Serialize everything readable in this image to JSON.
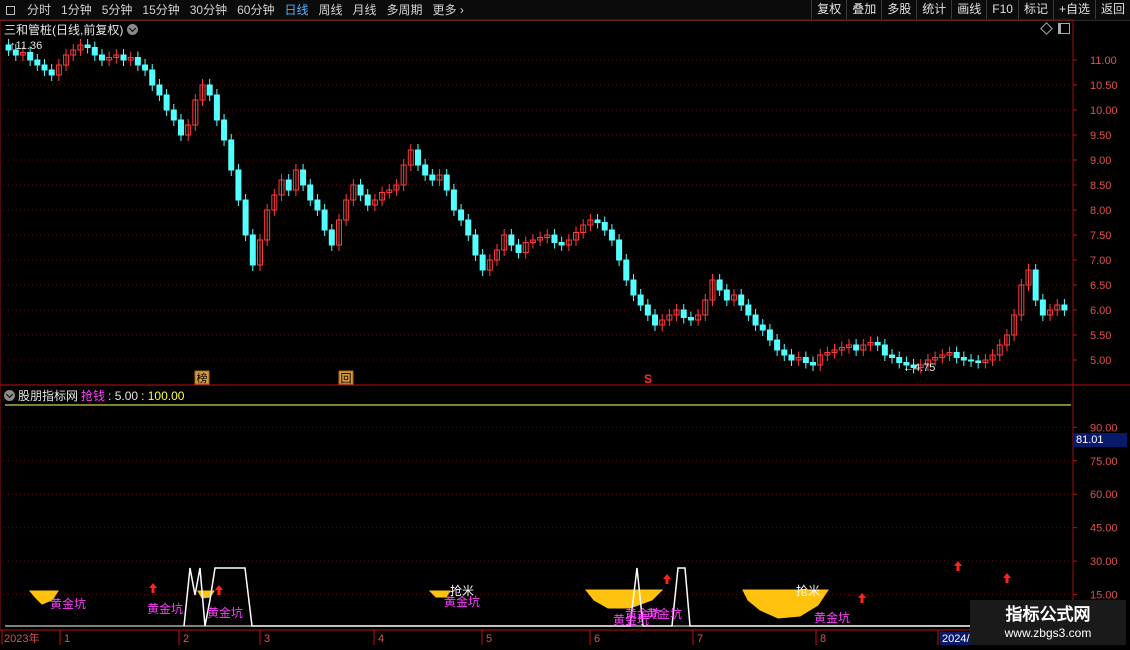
{
  "toolbar": {
    "periods": [
      {
        "label": "分时",
        "active": false
      },
      {
        "label": "1分钟",
        "active": false
      },
      {
        "label": "5分钟",
        "active": false
      },
      {
        "label": "15分钟",
        "active": false
      },
      {
        "label": "30分钟",
        "active": false
      },
      {
        "label": "60分钟",
        "active": false
      },
      {
        "label": "日线",
        "active": true
      },
      {
        "label": "周线",
        "active": false
      },
      {
        "label": "月线",
        "active": false
      },
      {
        "label": "多周期",
        "active": false
      },
      {
        "label": "更多",
        "active": false
      }
    ],
    "buttons": [
      "复权",
      "叠加",
      "多股",
      "统计",
      "画线",
      "F10",
      "标记",
      "+自选",
      "返回"
    ]
  },
  "chart_title": "三和管桩(日线,前复权)",
  "indicator": {
    "name": "股朋指标网",
    "param_label": "抢钱",
    "value_min": ": 5.00",
    "value_max": ": 100.00"
  },
  "indicator_badge": "81.01",
  "chart_data": [
    {
      "type": "candlestick",
      "axis_ticks": [
        "11.00",
        "10.50",
        "10.00",
        "9.50",
        "9.00",
        "8.50",
        "8.00",
        "7.50",
        "7.00",
        "6.50",
        "6.00",
        "5.50",
        "5.00"
      ],
      "ylim": [
        4.6,
        11.5
      ],
      "max_label": "11.36",
      "min_label": "←4.75",
      "series": [
        {
          "name": "close",
          "values": [
            11.2,
            11.1,
            11.15,
            11.0,
            10.9,
            10.8,
            10.7,
            10.9,
            11.1,
            11.2,
            11.3,
            11.25,
            11.1,
            11.0,
            11.05,
            11.1,
            11.0,
            11.05,
            10.9,
            10.8,
            10.5,
            10.3,
            10.0,
            9.8,
            9.5,
            9.7,
            10.2,
            10.5,
            10.3,
            9.8,
            9.4,
            8.8,
            8.2,
            7.5,
            6.9,
            7.4,
            8.0,
            8.3,
            8.6,
            8.4,
            8.8,
            8.5,
            8.2,
            8.0,
            7.6,
            7.3,
            7.8,
            8.2,
            8.5,
            8.3,
            8.1,
            8.2,
            8.35,
            8.4,
            8.5,
            8.9,
            9.2,
            8.9,
            8.7,
            8.6,
            8.7,
            8.4,
            8.0,
            7.8,
            7.5,
            7.1,
            6.8,
            7.0,
            7.2,
            7.5,
            7.3,
            7.15,
            7.35,
            7.4,
            7.45,
            7.5,
            7.35,
            7.3,
            7.4,
            7.55,
            7.7,
            7.8,
            7.75,
            7.6,
            7.4,
            7.0,
            6.6,
            6.3,
            6.1,
            5.9,
            5.7,
            5.8,
            5.9,
            6.0,
            5.85,
            5.8,
            5.9,
            6.2,
            6.6,
            6.4,
            6.2,
            6.3,
            6.1,
            5.9,
            5.7,
            5.6,
            5.4,
            5.2,
            5.1,
            5.0,
            5.05,
            4.95,
            4.9,
            5.1,
            5.15,
            5.2,
            5.25,
            5.3,
            5.2,
            5.3,
            5.35,
            5.3,
            5.1,
            5.05,
            4.95,
            4.9,
            4.85,
            4.9,
            5.0,
            5.05,
            5.1,
            5.15,
            5.05,
            5.0,
            4.98,
            4.95,
            5.0,
            5.1,
            5.3,
            5.5,
            5.9,
            6.5,
            6.8,
            6.2,
            5.9,
            6.0,
            6.1,
            6.0
          ]
        }
      ]
    },
    {
      "type": "area",
      "axis_ticks": [
        "90.00",
        "75.00",
        "60.00",
        "45.00",
        "30.00",
        "15.00"
      ],
      "ylim": [
        0,
        100
      ],
      "x": [
        "2023年",
        "1",
        "2",
        "3",
        "4",
        "5",
        "6",
        "7",
        "8",
        "2024/"
      ],
      "annotations": [
        {
          "text": "黄金坑",
          "kind": "label"
        },
        {
          "text": "黄金坑",
          "kind": "label"
        },
        {
          "text": "黄金坑",
          "kind": "label"
        },
        {
          "text": "黄金坑",
          "kind": "label"
        },
        {
          "text": "黄金坑",
          "kind": "label"
        },
        {
          "text": "黄金坑",
          "kind": "label"
        },
        {
          "text": "黄金坑",
          "kind": "label"
        },
        {
          "text": "黄金坑",
          "kind": "label"
        },
        {
          "text": "抢米",
          "kind": "label"
        },
        {
          "text": "抢米",
          "kind": "label"
        }
      ],
      "markers": [
        "榜",
        "回",
        "S"
      ]
    }
  ],
  "watermark": {
    "title": "指标公式网",
    "url": "www.zbgs3.com"
  }
}
